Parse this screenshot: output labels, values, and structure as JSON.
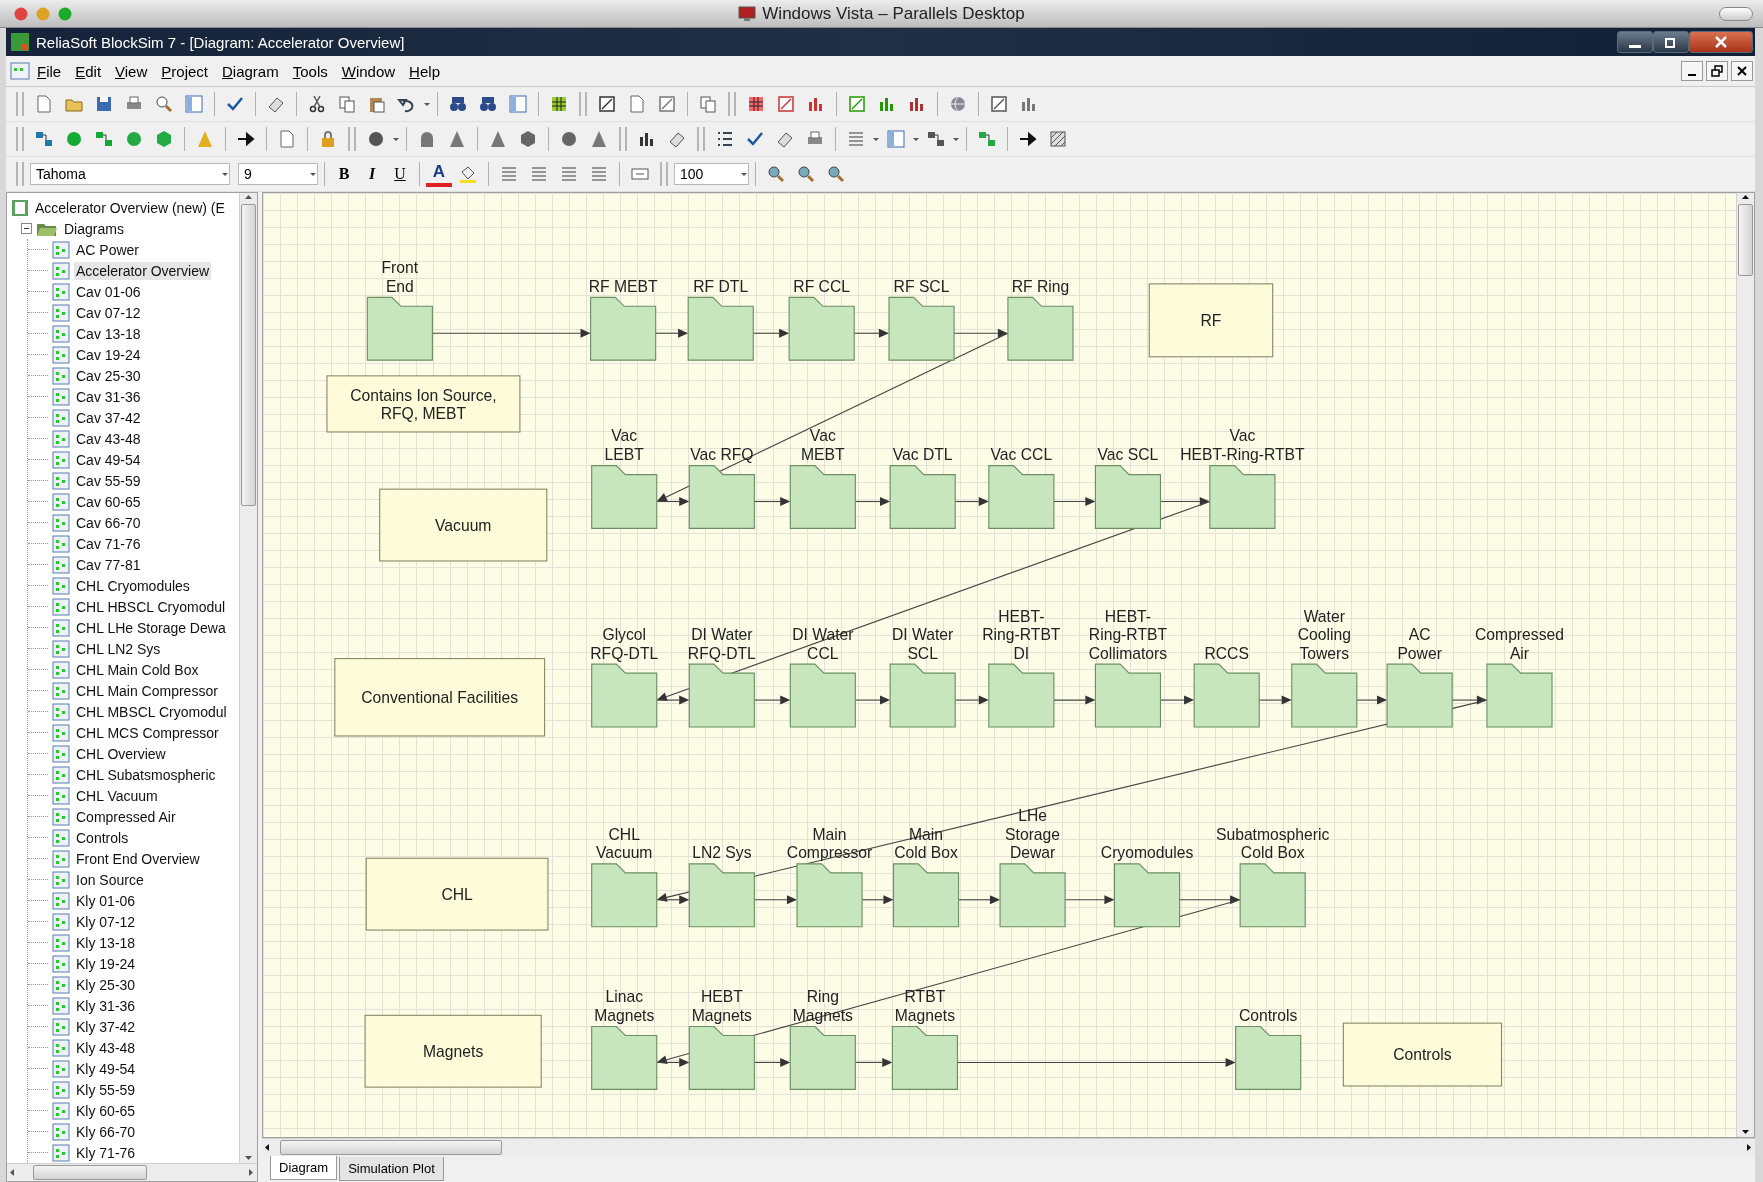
{
  "mac_window": {
    "title": "Windows Vista – Parallels Desktop"
  },
  "app_window": {
    "title": "ReliaSoft BlockSim 7 - [Diagram: Accelerator Overview]"
  },
  "menu": [
    "File",
    "Edit",
    "View",
    "Project",
    "Diagram",
    "Tools",
    "Window",
    "Help"
  ],
  "format_bar": {
    "font": "Tahoma",
    "size": "9",
    "bold": "B",
    "italic": "I",
    "underline": "U",
    "font_color": "A",
    "zoom": "100"
  },
  "project_tree": {
    "root": "Accelerator Overview (new) (E",
    "folder": {
      "label": "Diagrams",
      "expanded": true,
      "children": [
        {
          "label": "AC Power",
          "selected": false
        },
        {
          "label": "Accelerator Overview",
          "selected": true
        },
        {
          "label": "Cav 01-06",
          "selected": false
        },
        {
          "label": "Cav 07-12",
          "selected": false
        },
        {
          "label": "Cav 13-18",
          "selected": false
        },
        {
          "label": "Cav 19-24",
          "selected": false
        },
        {
          "label": "Cav 25-30",
          "selected": false
        },
        {
          "label": "Cav 31-36",
          "selected": false
        },
        {
          "label": "Cav 37-42",
          "selected": false
        },
        {
          "label": "Cav 43-48",
          "selected": false
        },
        {
          "label": "Cav 49-54",
          "selected": false
        },
        {
          "label": "Cav 55-59",
          "selected": false
        },
        {
          "label": "Cav 60-65",
          "selected": false
        },
        {
          "label": "Cav 66-70",
          "selected": false
        },
        {
          "label": "Cav 71-76",
          "selected": false
        },
        {
          "label": "Cav 77-81",
          "selected": false
        },
        {
          "label": "CHL Cryomodules",
          "selected": false
        },
        {
          "label": "CHL HBSCL Cryomodul",
          "selected": false
        },
        {
          "label": "CHL LHe Storage Dewa",
          "selected": false
        },
        {
          "label": "CHL LN2 Sys",
          "selected": false
        },
        {
          "label": "CHL Main Cold Box",
          "selected": false
        },
        {
          "label": "CHL Main Compressor",
          "selected": false
        },
        {
          "label": "CHL MBSCL Cryomodul",
          "selected": false
        },
        {
          "label": "CHL MCS Compressor",
          "selected": false
        },
        {
          "label": "CHL Overview",
          "selected": false
        },
        {
          "label": "CHL Subatsmospheric",
          "selected": false
        },
        {
          "label": "CHL Vacuum",
          "selected": false
        },
        {
          "label": "Compressed Air",
          "selected": false
        },
        {
          "label": "Controls",
          "selected": false
        },
        {
          "label": "Front End Overview",
          "selected": false
        },
        {
          "label": "Ion Source",
          "selected": false
        },
        {
          "label": "Kly 01-06",
          "selected": false
        },
        {
          "label": "Kly 07-12",
          "selected": false
        },
        {
          "label": "Kly 13-18",
          "selected": false
        },
        {
          "label": "Kly 19-24",
          "selected": false
        },
        {
          "label": "Kly 25-30",
          "selected": false
        },
        {
          "label": "Kly 31-36",
          "selected": false
        },
        {
          "label": "Kly 37-42",
          "selected": false
        },
        {
          "label": "Kly 43-48",
          "selected": false
        },
        {
          "label": "Kly 49-54",
          "selected": false
        },
        {
          "label": "Kly 55-59",
          "selected": false
        },
        {
          "label": "Kly 60-65",
          "selected": false
        },
        {
          "label": "Kly 66-70",
          "selected": false
        },
        {
          "label": "Kly 71-76",
          "selected": false
        }
      ]
    }
  },
  "diagram": {
    "rows": [
      {
        "blocks": [
          "Front\nEnd",
          "RF MEBT",
          "RF DTL",
          "RF CCL",
          "RF SCL",
          "RF Ring"
        ]
      },
      {
        "blocks": [
          "Vac\nLEBT",
          "Vac RFQ",
          "Vac\nMEBT",
          "Vac DTL",
          "Vac CCL",
          "Vac SCL",
          "Vac\nHEBT-Ring-RTBT"
        ]
      },
      {
        "blocks": [
          "Glycol\nRFQ-DTL",
          "DI Water\nRFQ-DTL",
          "DI Water\nCCL",
          "DI Water\nSCL",
          "HEBT-\nRing-RTBT\nDI",
          "HEBT-\nRing-RTBT\nCollimators",
          "RCCS",
          "Water\nCooling\nTowers",
          "AC\nPower",
          "Compressed\nAir"
        ]
      },
      {
        "blocks": [
          "CHL\nVacuum",
          "LN2 Sys",
          "Main\nCompressor",
          "Main\nCold Box",
          "LHe\nStorage\nDewar",
          "Cryomodules",
          "Subatmospheric\nCold Box"
        ]
      },
      {
        "blocks": [
          "Linac\nMagnets",
          "HEBT\nMagnets",
          "Ring\nMagnets",
          "RTBT\nMagnets",
          "Controls"
        ]
      }
    ],
    "notes": [
      "RF",
      "Contains Ion Source,\nRFQ, MEBT",
      "Vacuum",
      "Conventional Facilities",
      "CHL",
      "Magnets",
      "Controls"
    ]
  },
  "tabs": [
    {
      "label": "Diagram",
      "selected": true
    },
    {
      "label": "Simulation Plot",
      "selected": false
    }
  ]
}
